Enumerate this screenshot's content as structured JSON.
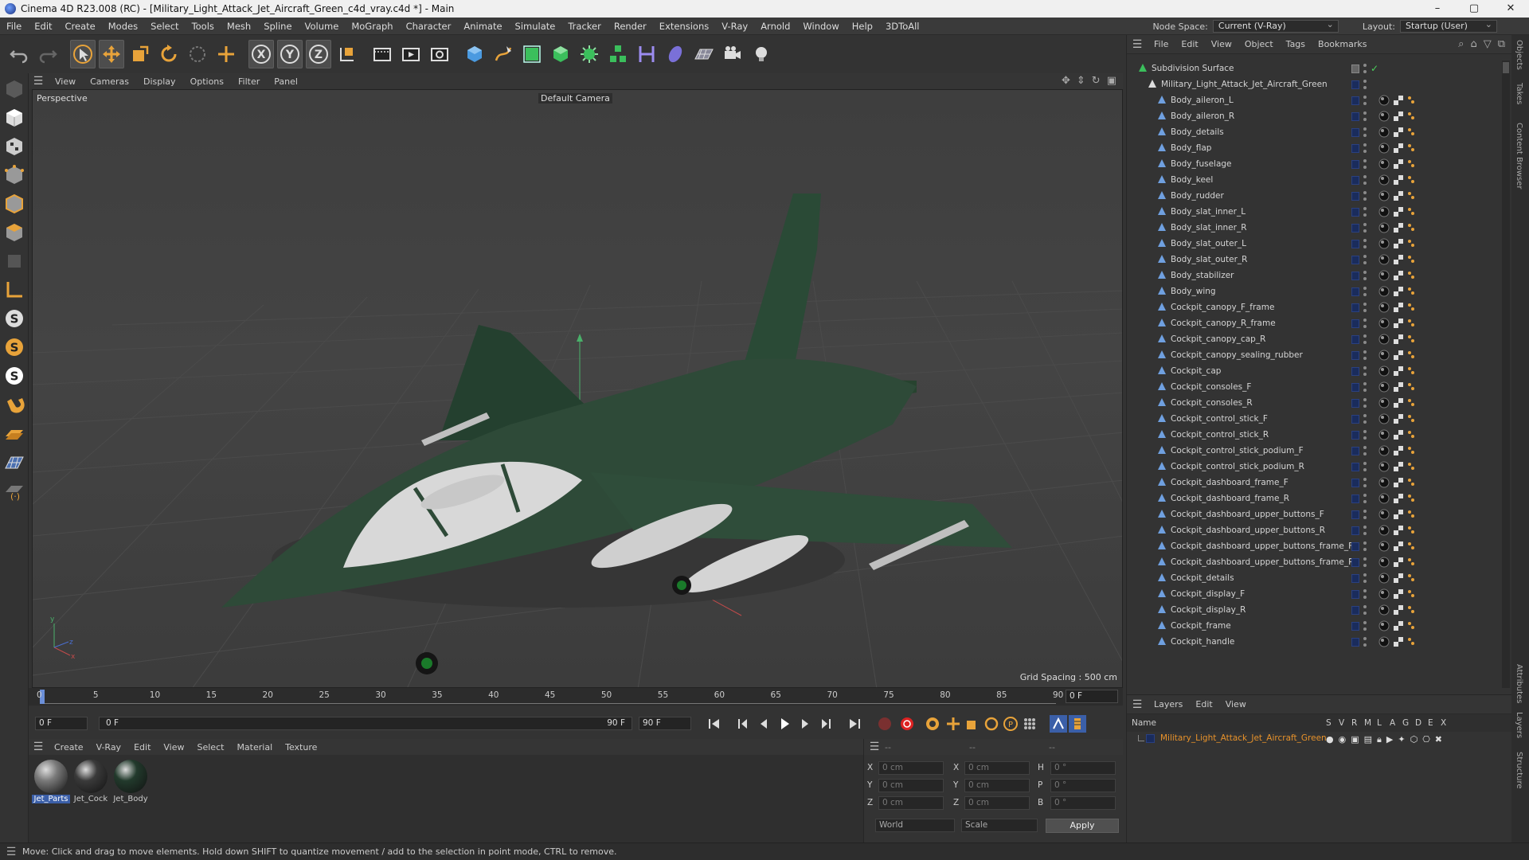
{
  "window": {
    "title": "Cinema 4D R23.008 (RC) - [Military_Light_Attack_Jet_Aircraft_Green_c4d_vray.c4d *] - Main",
    "controls": [
      "–",
      "▢",
      "✕"
    ]
  },
  "menubar": {
    "items": [
      "File",
      "Edit",
      "Create",
      "Modes",
      "Select",
      "Tools",
      "Mesh",
      "Spline",
      "Volume",
      "MoGraph",
      "Character",
      "Animate",
      "Simulate",
      "Tracker",
      "Render",
      "Extensions",
      "V-Ray",
      "Arnold",
      "Window",
      "Help",
      "3DToAll"
    ],
    "node_space_label": "Node Space:",
    "node_space_value": "Current (V-Ray)",
    "layout_label": "Layout:",
    "layout_value": "Startup (User)"
  },
  "toolbar": {
    "icons": [
      "undo-icon",
      "redo-icon",
      "select-pointer-icon",
      "move-icon",
      "scale-icon",
      "rotate-icon",
      "live-selection-icon",
      "coordinate-icon",
      "x-axis-icon",
      "y-axis-icon",
      "z-axis-icon",
      "coordinate-system-icon",
      "render-view-icon",
      "render-picture-viewer-icon",
      "render-settings-icon",
      "cube-icon",
      "pen-icon",
      "subdivision-icon",
      "extrude-icon",
      "cloner-icon",
      "array-icon",
      "bend-icon",
      "deformer-icon",
      "floor-icon",
      "camera-icon",
      "light-icon"
    ]
  },
  "viewport": {
    "menu": [
      "View",
      "Cameras",
      "Display",
      "Options",
      "Filter",
      "Panel"
    ],
    "label": "Perspective",
    "camera": "Default Camera",
    "grid_spacing": "Grid Spacing : 500 cm"
  },
  "timeline": {
    "ticks": [
      "0",
      "5",
      "10",
      "15",
      "20",
      "25",
      "30",
      "35",
      "40",
      "45",
      "50",
      "55",
      "60",
      "65",
      "70",
      "75",
      "80",
      "85",
      "90"
    ],
    "current_frame": "0 F",
    "start_field": "0 F",
    "range_start": "0 F",
    "range_end": "90 F",
    "end_field": "90 F"
  },
  "material_manager": {
    "menu": [
      "Create",
      "V-Ray",
      "Edit",
      "View",
      "Select",
      "Material",
      "Texture"
    ],
    "materials": [
      {
        "name": "Jet_Parts",
        "selected": true,
        "color": "#7a7a7a"
      },
      {
        "name": "Jet_Cock",
        "selected": false,
        "color": "#3a3a3a"
      },
      {
        "name": "Jet_Body",
        "selected": false,
        "color": "#223a2c"
      }
    ]
  },
  "coordinates": {
    "headers": [
      "--",
      "--",
      "--"
    ],
    "rows": [
      {
        "a_label": "X",
        "a_val": "0 cm",
        "b_label": "X",
        "b_val": "0 cm",
        "c_label": "H",
        "c_val": "0 °"
      },
      {
        "a_label": "Y",
        "a_val": "0 cm",
        "b_label": "Y",
        "b_val": "0 cm",
        "c_label": "P",
        "c_val": "0 °"
      },
      {
        "a_label": "Z",
        "a_val": "0 cm",
        "b_label": "Z",
        "b_val": "0 cm",
        "c_label": "B",
        "c_val": "0 °"
      }
    ],
    "world": "World",
    "scale": "Scale",
    "apply": "Apply"
  },
  "status": {
    "text": "Move: Click and drag to move elements. Hold down SHIFT to quantize movement / add to the selection in point mode, CTRL to remove."
  },
  "object_manager": {
    "menu": [
      "File",
      "Edit",
      "View",
      "Object",
      "Tags",
      "Bookmarks"
    ],
    "root": "Subdivision Surface",
    "group": "Military_Light_Attack_Jet_Aircraft_Green",
    "objects": [
      "Body_aileron_L",
      "Body_aileron_R",
      "Body_details",
      "Body_flap",
      "Body_fuselage",
      "Body_keel",
      "Body_rudder",
      "Body_slat_inner_L",
      "Body_slat_inner_R",
      "Body_slat_outer_L",
      "Body_slat_outer_R",
      "Body_stabilizer",
      "Body_wing",
      "Cockpit_canopy_F_frame",
      "Cockpit_canopy_R_frame",
      "Cockpit_canopy_cap_R",
      "Cockpit_canopy_sealing_rubber",
      "Cockpit_cap",
      "Cockpit_consoles_F",
      "Cockpit_consoles_R",
      "Cockpit_control_stick_F",
      "Cockpit_control_stick_R",
      "Cockpit_control_stick_podium_F",
      "Cockpit_control_stick_podium_R",
      "Cockpit_dashboard_frame_F",
      "Cockpit_dashboard_frame_R",
      "Cockpit_dashboard_upper_buttons_F",
      "Cockpit_dashboard_upper_buttons_R",
      "Cockpit_dashboard_upper_buttons_frame_F",
      "Cockpit_dashboard_upper_buttons_frame_R",
      "Cockpit_details",
      "Cockpit_display_F",
      "Cockpit_display_R",
      "Cockpit_frame",
      "Cockpit_handle"
    ]
  },
  "layers": {
    "menu": [
      "Layers",
      "Edit",
      "View"
    ],
    "col_name": "Name",
    "cols": [
      "S",
      "V",
      "R",
      "M",
      "L",
      "A",
      "G",
      "D",
      "E",
      "X"
    ],
    "layer_name": "Military_Light_Attack_Jet_Aircraft_Green"
  },
  "side_tabs": [
    "Objects",
    "Takes",
    "Content Browser",
    "Attributes",
    "Layers",
    "Structure"
  ],
  "colors": {
    "accent": "#3b5fa8",
    "layer_text": "#e8922a",
    "jet_green": "#2e4a38"
  }
}
